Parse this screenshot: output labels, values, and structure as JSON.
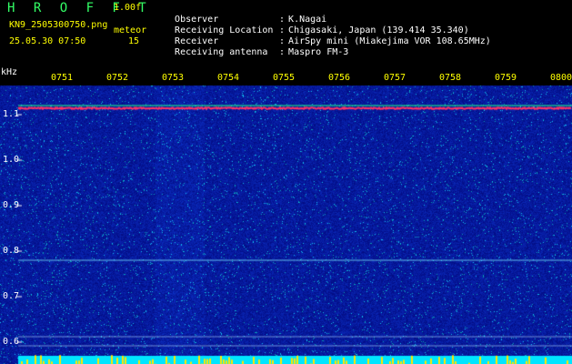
{
  "header": {
    "app_name": "H R O F F T",
    "version": "1.00f",
    "filename": "KN9_2505300750.png",
    "counter_label": "meteor",
    "timestamp": "25.05.30 07:50",
    "counter_value": "15"
  },
  "meta": [
    {
      "key": "Observer",
      "value": "K.Nagai"
    },
    {
      "key": "Receiving Location",
      "value": "Chigasaki, Japan (139.414 35.340)"
    },
    {
      "key": "Receiver",
      "value": "AirSpy mini (Miakejima VOR 108.65MHz)"
    },
    {
      "key": "Receiving antenna",
      "value": "Maspro FM-3"
    }
  ],
  "axis": {
    "y_unit": "kHz",
    "time_ticks": [
      "0751",
      "0752",
      "0753",
      "0754",
      "0755",
      "0756",
      "0757",
      "0758",
      "0759",
      "0800"
    ],
    "freq_ticks": [
      "1.1",
      "1.0",
      "0.9",
      "0.8",
      "0.7",
      "0.6"
    ]
  },
  "colors": {
    "background": "#0a1a6e",
    "carrier": "#ff3366",
    "label": "#ffff00",
    "baseline": "#00e5ff"
  }
}
